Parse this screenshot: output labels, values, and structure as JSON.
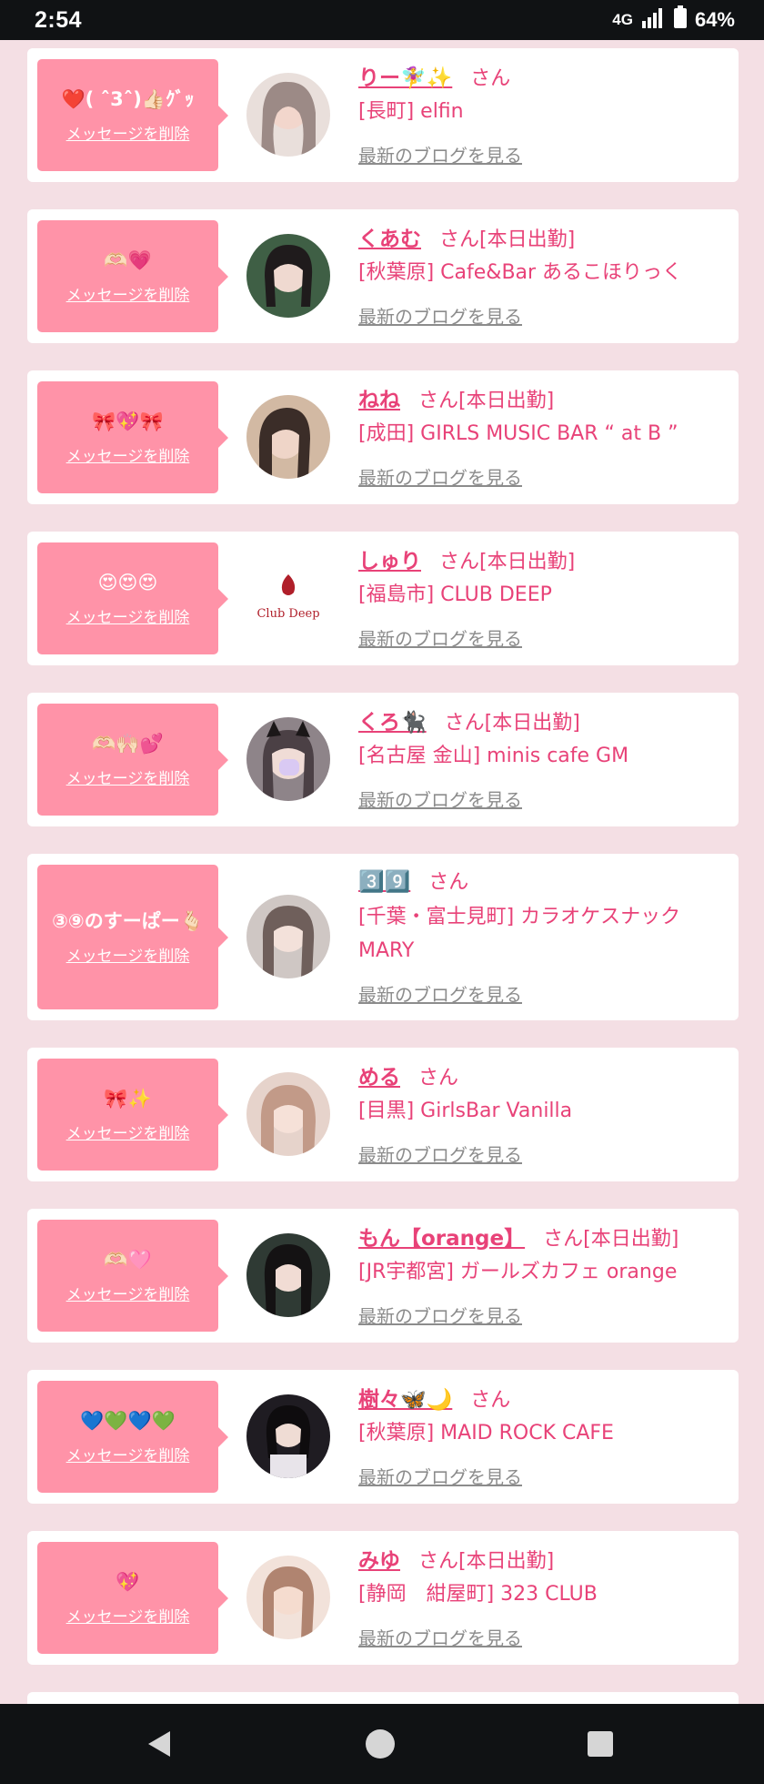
{
  "status_bar": {
    "time": "2:54",
    "network": "4G",
    "battery": "64%"
  },
  "cards": [
    {
      "message": "❤️( ˆ3ˆ)👍🏻ｸﾞｯ",
      "delete_label": "メッセージを削除",
      "name": "りー🧚‍♀️✨",
      "suffix": "さん",
      "shop": "[長町] elfin",
      "blog_label": "最新のブログを見る",
      "avatar_color": "#c9b7b2"
    },
    {
      "message": "🫶🏻💗",
      "delete_label": "メッセージを削除",
      "name": "くあむ",
      "suffix": "さん[本日出勤]",
      "shop": "[秋葉原] Cafe&Bar あるこほりっく",
      "blog_label": "最新のブログを見る",
      "avatar_color": "#4e6b4f"
    },
    {
      "message": "🎀💖🎀",
      "delete_label": "メッセージを削除",
      "name": "ねね",
      "suffix": "さん[本日出勤]",
      "shop": "[成田] GIRLS MUSIC BAR “ at B ”",
      "blog_label": "最新のブログを見る",
      "avatar_color": "#6d5a4e"
    },
    {
      "message": "😍😍😍",
      "delete_label": "メッセージを削除",
      "name": "しゅり",
      "suffix": "さん[本日出勤]",
      "shop": "[福島市] CLUB DEEP",
      "blog_label": "最新のブログを見る",
      "avatar_logo": "Club Deep",
      "avatar_color": "#ffffff"
    },
    {
      "message": "🫶🏻🙌🏻💕",
      "delete_label": "メッセージを削除",
      "name": "くろ🐈‍⬛",
      "suffix": "さん[本日出勤]",
      "shop": "[名古屋 金山] minis cafe GM",
      "blog_label": "最新のブログを見る",
      "avatar_color": "#9a8f95"
    },
    {
      "message": "③⑨のすーぱー🫰🏻",
      "delete_label": "メッセージを削除",
      "name": "3️⃣9️⃣",
      "suffix": "さん",
      "shop": "[千葉・富士見町] カラオケスナック MARY",
      "blog_label": "最新のブログを見る",
      "avatar_color": "#b5a9a6"
    },
    {
      "message": "🎀✨",
      "delete_label": "メッセージを削除",
      "name": "める",
      "suffix": "さん",
      "shop": "[目黒] GirlsBar Vanilla",
      "blog_label": "最新のブログを見る",
      "avatar_color": "#d8b9b0"
    },
    {
      "message": "🫶🏻🩷",
      "delete_label": "メッセージを削除",
      "name": "もん【orange】",
      "suffix": "さん[本日出勤]",
      "shop": "[JR宇都宮] ガールズカフェ orange",
      "blog_label": "最新のブログを見る",
      "avatar_color": "#3a3535"
    },
    {
      "message": "💙💚💙💚",
      "delete_label": "メッセージを削除",
      "name": "樹々🦋🌙",
      "suffix": "さん",
      "shop": "[秋葉原] MAID ROCK CAFE",
      "blog_label": "最新のブログを見る",
      "avatar_color": "#2c2a2f"
    },
    {
      "message": "💖",
      "delete_label": "メッセージを削除",
      "name": "みゆ",
      "suffix": "さん[本日出勤]",
      "shop": "[静岡　紺屋町] 323 CLUB",
      "blog_label": "最新のブログを見る",
      "avatar_color": "#e2c3b4"
    }
  ],
  "nav": {
    "back_icon": "back-triangle-icon",
    "home_icon": "home-circle-icon",
    "recents_icon": "recents-square-icon"
  }
}
